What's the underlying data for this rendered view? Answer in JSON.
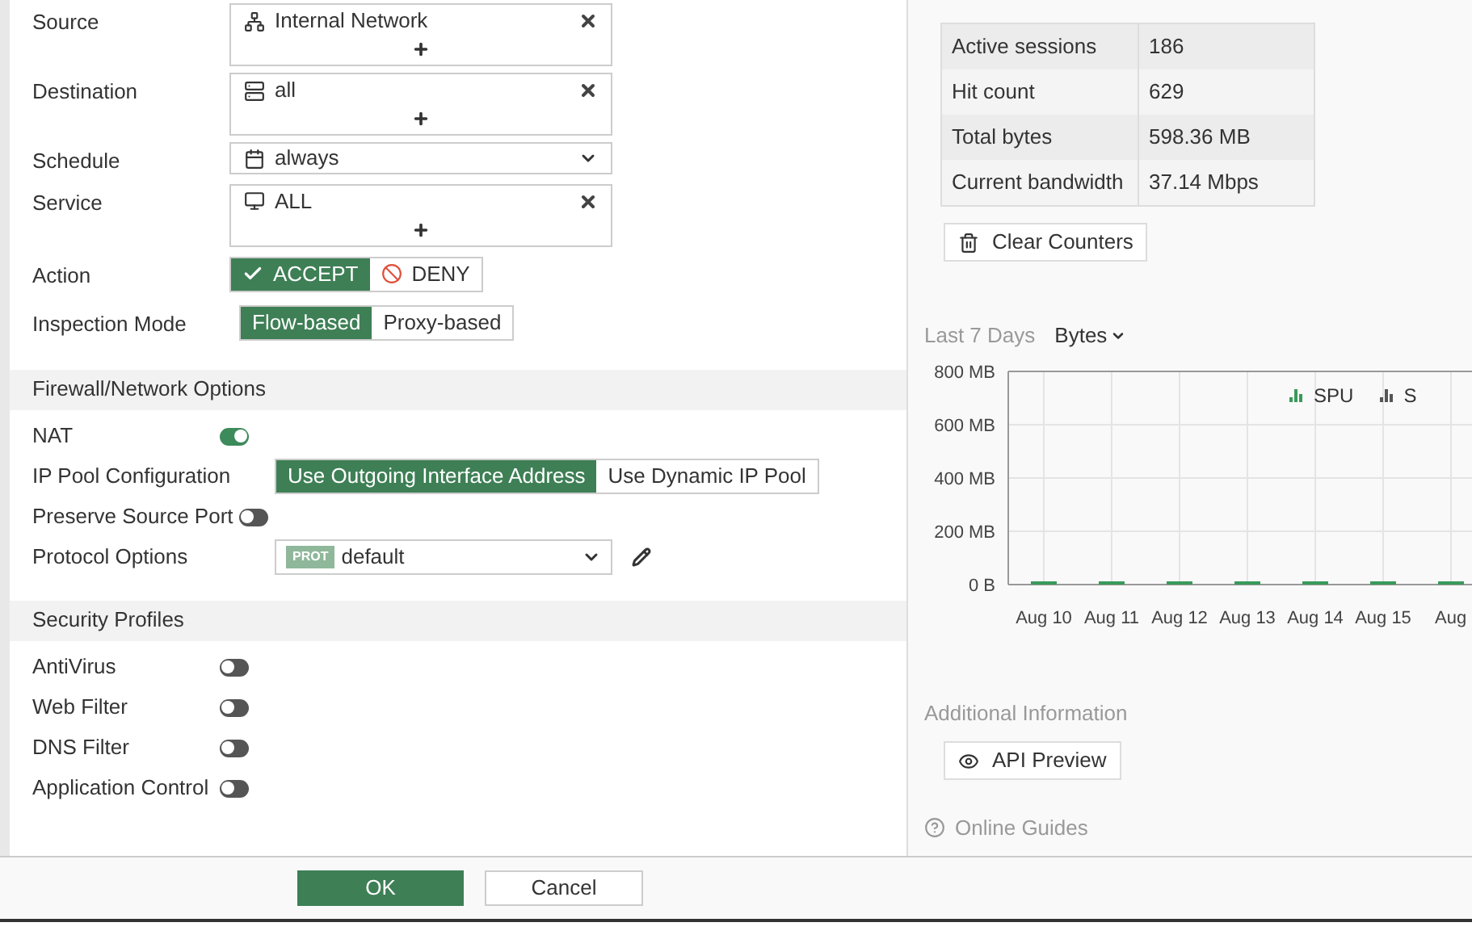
{
  "policy": {
    "fields": [
      {
        "kind": "multi",
        "label": "Source",
        "value": "Internal Network"
      },
      {
        "kind": "multi",
        "label": "Destination",
        "value": "all"
      },
      {
        "kind": "select",
        "label": "Schedule",
        "value": "always"
      },
      {
        "kind": "multi",
        "label": "Service",
        "value": "ALL"
      },
      {
        "kind": "segmented",
        "label": "Action",
        "options": [
          {
            "kind": "accept",
            "label": "ACCEPT",
            "selected": true
          },
          {
            "kind": "deny",
            "label": "DENY",
            "selected": false
          }
        ]
      },
      {
        "kind": "segmented",
        "label": "Inspection Mode",
        "options": [
          {
            "label": "Flow-based",
            "selected": true
          },
          {
            "label": "Proxy-based",
            "selected": false
          }
        ]
      }
    ]
  },
  "sections": [
    {
      "title": "Firewall/Network Options",
      "rows": [
        {
          "kind": "toggle",
          "label": "NAT",
          "on": true
        },
        {
          "kind": "segmented",
          "label": "IP Pool Configuration",
          "options": [
            {
              "label": "Use Outgoing Interface Address",
              "selected": true
            },
            {
              "label": "Use Dynamic IP Pool",
              "selected": false
            }
          ]
        },
        {
          "kind": "toggle",
          "label": "Preserve Source Port",
          "on": false
        },
        {
          "kind": "select",
          "label": "Protocol Options",
          "badge": "PROT",
          "value": "default"
        }
      ]
    },
    {
      "title": "Security Profiles",
      "rows": [
        {
          "kind": "toggle",
          "label": "AntiVirus",
          "on": false
        },
        {
          "kind": "toggle",
          "label": "Web Filter",
          "on": false
        },
        {
          "kind": "toggle",
          "label": "DNS Filter",
          "on": false
        },
        {
          "kind": "toggle",
          "label": "Application Control",
          "on": false
        }
      ]
    }
  ],
  "statistics": {
    "rows": [
      {
        "label": "Active sessions",
        "value": "186"
      },
      {
        "label": "Hit count",
        "value": "629"
      },
      {
        "label": "Total bytes",
        "value": "598.36 MB"
      },
      {
        "label": "Current bandwidth",
        "value": "37.14 Mbps"
      }
    ],
    "clear_button": "Clear Counters"
  },
  "traffic": {
    "period": "Last 7 Days",
    "metric": "Bytes",
    "extra_legend": [
      {
        "label": "S",
        "color": "#555555"
      }
    ],
    "chart_data": {
      "type": "bar",
      "grid": true,
      "categories": [
        "Aug 10",
        "Aug 11",
        "Aug 12",
        "Aug 13",
        "Aug 14",
        "Aug 15",
        "Aug"
      ],
      "series": [
        {
          "name": "SPU",
          "color": "#3a9a5a",
          "values": [
            0,
            0,
            0,
            0,
            0,
            0,
            0
          ]
        }
      ],
      "ylim": [
        0,
        800
      ],
      "yticks": [
        {
          "value": 0,
          "label": "0 B"
        },
        {
          "value": 200,
          "label": "200 MB"
        },
        {
          "value": 400,
          "label": "400 MB"
        },
        {
          "value": 600,
          "label": "600 MB"
        },
        {
          "value": 800,
          "label": "800 MB"
        }
      ]
    }
  },
  "additional": {
    "title": "Additional Information",
    "api_button": "API Preview",
    "guides_link": "Online Guides"
  },
  "footer": {
    "ok": "OK",
    "cancel": "Cancel"
  }
}
